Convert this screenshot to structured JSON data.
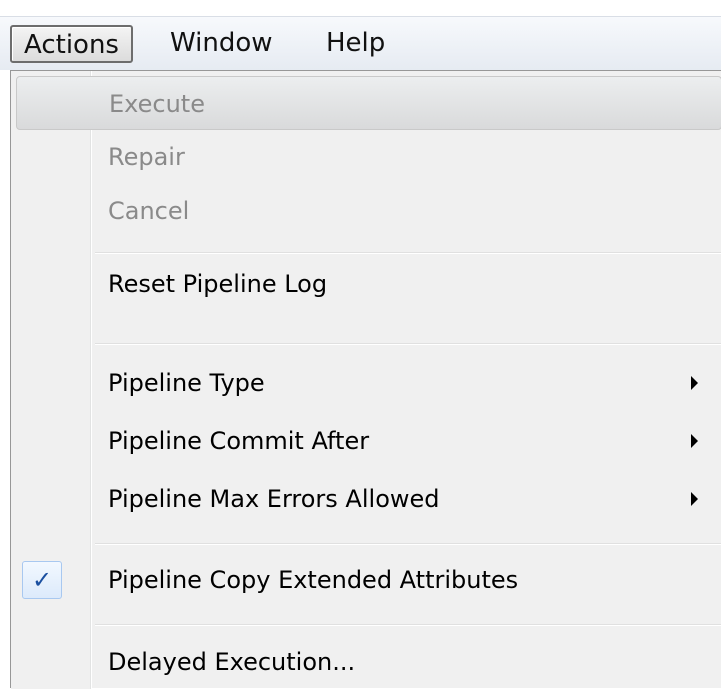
{
  "menubar": {
    "items": [
      {
        "label": "Actions"
      },
      {
        "label": "Window"
      },
      {
        "label": "Help"
      }
    ]
  },
  "menu": {
    "execute": "Execute",
    "repair": "Repair",
    "cancel": "Cancel",
    "reset_log": "Reset Pipeline Log",
    "pipeline_type": "Pipeline Type",
    "commit_after": "Pipeline Commit After",
    "max_errors": "Pipeline Max Errors Allowed",
    "copy_attributes": "Pipeline Copy Extended Attributes",
    "delayed_execution": "Delayed Execution...",
    "check_mark": "✓",
    "copy_attributes_checked": true,
    "check_icon": "check-mark-icon",
    "submenu_icon": "chevron-right-icon"
  }
}
